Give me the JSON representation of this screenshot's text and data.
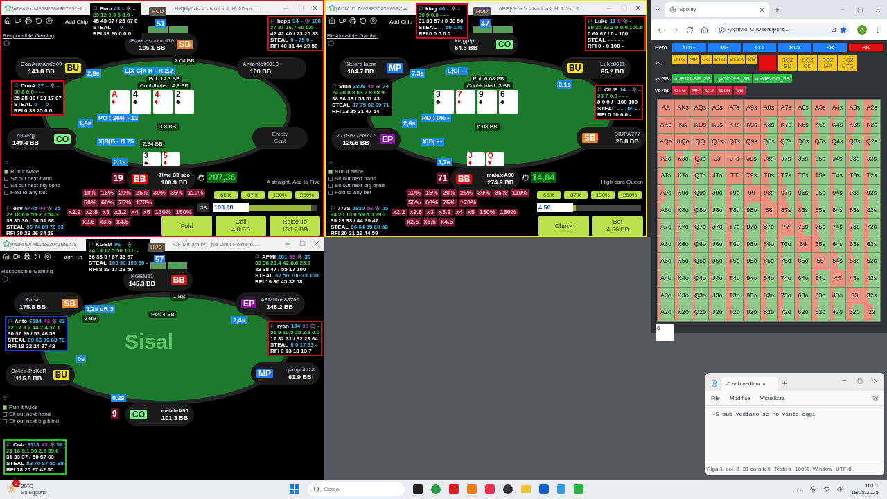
{
  "tables": [
    {
      "color": "#e01020",
      "title_left": "[ADM ID: M628E3043E7F51HL",
      "title_right": "HK]Hybris V - No Limit Hold'em…",
      "add_chips": "Add Chip",
      "hud_button": "HUD",
      "responsible": "Responsible Gaming",
      "top_number": "51",
      "hole_number": "19",
      "seats": [
        {
          "kind": "player",
          "name": "Francescomoi10",
          "stack": "105.1 BB",
          "badge": {
            "label": "SB",
            "color": "#f07c1c"
          }
        },
        {
          "kind": "player",
          "name": "DonArmando00",
          "stack": "143.8 BB",
          "badge": {
            "label": "BU",
            "color": "#f4e618"
          },
          "timer": "2,8s"
        },
        {
          "kind": "player",
          "name": "oliverjj",
          "stack": "149.4 BB",
          "badge": {
            "label": "CO",
            "color": "#7ef58a"
          },
          "timer": "1,8s"
        },
        {
          "kind": "hero",
          "name": "Time 33 sec",
          "stack": "100.9 BB",
          "badge": {
            "label": "BB",
            "color": "#e01010"
          },
          "timer": "2,1s"
        },
        {
          "kind": "empty",
          "name": "Empty Seat"
        },
        {
          "kind": "player",
          "name": "Antonio00118",
          "stack": "100 BB"
        }
      ],
      "pot": "Pot: 14.3 BB",
      "contributed": "Contributed: 4.8 BB",
      "board": [
        {
          "rank": "A",
          "suit": "♦",
          "color": "#d40000"
        },
        {
          "rank": "4",
          "suit": "♣",
          "color": "#111111"
        },
        {
          "rank": "4",
          "suit": "♦",
          "color": "#d40000"
        },
        {
          "rank": "2",
          "suit": "♣",
          "color": "#111111"
        }
      ],
      "hole_cards": [
        {
          "rank": "3",
          "suit": "♠",
          "color": "#111111"
        },
        {
          "rank": "5",
          "suit": "♦",
          "color": "#d40000"
        }
      ],
      "bets": [
        "7.64 BB",
        "3.8 BB",
        "2.84 BB"
      ],
      "action_labels": [
        "L|X C|X R - R 2,7",
        "PO : 26% - 12",
        "X|B|B - B 75"
      ],
      "huds": [
        {
          "color": "#000000",
          "name": "Fran",
          "count": "43",
          "mid": "-",
          "tail": "-",
          "line2": "29 12 0.0 0 8.9 -",
          "line3": "45 43 67 / 25 67 0",
          "steal_label": "STEAL",
          "steal": "- - 0 - -",
          "rfi": "RFI 33 20 0 0 0"
        },
        {
          "color": "#d0101e",
          "name": "bepp",
          "count": "94",
          "mid": "-",
          "tail": "100",
          "line2": "37 27 16.7 60 0.0 -",
          "line3": "42 42 40 / 73 20 33",
          "steal_label": "STEAL",
          "steal": "0 - 75 0 -",
          "rfi": "RFI 40 31 44 29 50"
        },
        {
          "color": "#d0101e",
          "name": "DonA",
          "count": "27",
          "mid": "-",
          "tail": "-",
          "line2": "50 8 0.0 - - -",
          "line3": "25 25 38 / 13 17 67",
          "steal_label": "STEAL",
          "steal": "0 - - 0 -",
          "rfi": "RFI 0 33 25 0 0"
        },
        {
          "color": "#000000",
          "name": "oliv",
          "count": "6445",
          "mid": "44",
          "tail": "65",
          "line2": "22 18 8.6 55 2.2 54.3",
          "line3": "36 35 30 / 56 51 68",
          "steal_label": "STEAL",
          "steal": "90 74 89 70 63",
          "rfi": "RFI 20 23 26 34 39"
        }
      ],
      "options": [
        {
          "label": "Run it twice",
          "checked": true
        },
        {
          "label": "Sit out next hand",
          "checked": false
        },
        {
          "label": "Sit out next big blind",
          "checked": false
        },
        {
          "label": "Fold to any bet",
          "checked": false
        }
      ],
      "balance": "207,36",
      "hand_name": "A straight, Ace to Five",
      "sizing_rows": [
        [
          "10%",
          "15%",
          "20%",
          "25%",
          "30%",
          "35%",
          "110%"
        ],
        [
          "50%",
          "60%",
          "75%",
          "170%"
        ],
        [
          "x2.2",
          "x2.8",
          "x3",
          "x3.2",
          "x4",
          "x5",
          "130%",
          "150%"
        ],
        [
          "x2.5",
          "x3.5",
          "x4.5"
        ]
      ],
      "presets": [
        "65%",
        "87%",
        "130%",
        "250%"
      ],
      "bb_box": "33",
      "amount": "103.68",
      "slider": {
        "level": 0.92
      },
      "actions": [
        {
          "label": "Fold"
        },
        {
          "label": "Call",
          "sub": "4.8 BB"
        },
        {
          "label": "Raise To",
          "sub": "103.7 BB"
        }
      ]
    },
    {
      "color": "#f2e600",
      "title_left": "[ADM ID: M628E3043E85FCW",
      "title_right": "0PP]Vera V - No Limit Hold'em €…",
      "add_chips": "Add Chip",
      "hud_button": "HUD",
      "responsible": "Responsible Gaming",
      "top_number": "47",
      "hole_number": "71",
      "seats": [
        {
          "kind": "player",
          "name": "kingpipp",
          "stack": "64.3 BB",
          "badge": {
            "label": "CO",
            "color": "#7ef58a"
          }
        },
        {
          "kind": "player",
          "name": "StuartHazar",
          "stack": "104.7 BB",
          "badge": {
            "label": "MP",
            "color": "#1e7cf0"
          },
          "timer": "7,3s"
        },
        {
          "kind": "player",
          "name": "777Se77eN777",
          "stack": "126.6 BB",
          "badge": {
            "label": "EP",
            "color": "#8a1aa0"
          },
          "timer": "2,6s"
        },
        {
          "kind": "hero",
          "name": "maiaieA90",
          "stack": "274.9 BB",
          "badge": {
            "label": "BB",
            "color": "#e01010"
          },
          "timer": "3,7s"
        },
        {
          "kind": "player",
          "name": "CIUPA777",
          "stack": "25.8 BB",
          "badge": {
            "label": "SB",
            "color": "#f07c1c"
          }
        },
        {
          "kind": "player",
          "name": "Luke8611",
          "stack": "95.2 BB",
          "badge": {
            "label": "BU",
            "color": "#f4e618"
          },
          "timer": "0,1s"
        }
      ],
      "pot": "Pot: 6.08 BB",
      "contributed": "Contributed: 3 BB",
      "board": [
        {
          "rank": "3",
          "suit": "♣",
          "color": "#111111"
        },
        {
          "rank": "7",
          "suit": "♦",
          "color": "#d40000"
        },
        {
          "rank": "9",
          "suit": "♠",
          "color": "#111111"
        },
        {
          "rank": "6",
          "suit": "♣",
          "color": "#111111"
        }
      ],
      "hole_cards": [
        {
          "rank": "J",
          "suit": "♦",
          "color": "#d40000"
        },
        {
          "rank": "Q",
          "suit": "♥",
          "color": "#d40000"
        }
      ],
      "bets": [
        "6.08 BB"
      ],
      "action_labels": [
        "L|C| - -",
        "PO : 0% -",
        "X|B| - -"
      ],
      "huds": [
        {
          "color": "#d0101e",
          "name": "king",
          "count": "46",
          "mid": "-",
          "tail": "-",
          "line2": "39 0 0.0 - - -",
          "line3": "31 33 57 / 0 33 50",
          "steal_label": "STEAL",
          "steal": "- - 50 100 -",
          "rfi": "RFI 0 0 0 0 0"
        },
        {
          "color": "#d0101e",
          "name": "Luke",
          "count": "11",
          "mid": "0",
          "tail": "-",
          "line2": "60 20 33.3 0 0.0 100.0",
          "line3": "0 60 67 / 0 - 100",
          "steal_label": "STEAL",
          "steal": "- - - - -",
          "rfi": "RFI 0 - 0 100 -"
        },
        {
          "color": "#000000",
          "name": "Stua",
          "count": "3308",
          "mid": "45",
          "tail": "74",
          "line2": "24 20 8.8 63 2.8 88.9",
          "line3": "38 36 38 / 58 51 43",
          "steal_label": "STEAL",
          "steal": "87 75 92 69 71",
          "rfi": "RFI 18 25 31 47 54"
        },
        {
          "color": "#d0101e",
          "name": "CIUP",
          "count": "14",
          "mid": "-",
          "tail": "-",
          "line2": "29 7 0.0 - - -",
          "line3": "0 0 0 / - 100 100",
          "steal_label": "STEAL",
          "steal": "- - 100 - -",
          "rfi": "RFI 0 50 0 0 -"
        },
        {
          "color": "#000000",
          "name": "777S",
          "count": "1830",
          "mid": "56",
          "tail": "25",
          "line2": "24 20 13.0 59 5.0 29.2",
          "line3": "39 29 33 / 44 39 47",
          "steal_label": "STEAL",
          "steal": "86 64 85 60 38",
          "rfi": "RFI 20 21 29 44 59"
        }
      ],
      "options": [
        {
          "label": "Run it twice",
          "checked": true
        },
        {
          "label": "Sit out next hand",
          "checked": false
        },
        {
          "label": "Sit out next big blind",
          "checked": false
        },
        {
          "label": "Fold to any bet",
          "checked": false
        }
      ],
      "balance": "14,84",
      "hand_name": "High card Queen",
      "sizing_rows": [
        [
          "10%",
          "15%",
          "20%",
          "25%",
          "30%",
          "35%",
          "110%"
        ],
        [
          "50%",
          "60%",
          "75%",
          "170%"
        ],
        [
          "x2.2",
          "x2.8",
          "x3",
          "x3.2",
          "x4",
          "x5",
          "130%",
          "150%"
        ],
        [
          "x2.5",
          "x3.5",
          "x4.5"
        ]
      ],
      "presets": [
        "65%",
        "87%",
        "130%",
        "250%"
      ],
      "amount": "4.56",
      "slider": {
        "level": 0.04
      },
      "actions": [
        {
          "label": "Check"
        },
        {
          "label": "Bet",
          "sub": "4.56 BB"
        }
      ]
    },
    {
      "title_left": "[ADM ID: M628E3043E82D8",
      "title_right": "OF]Miriam IV - No Limit Hold'em…",
      "add_chips": "Add Ch",
      "hud_button": "HUD",
      "responsible": "Responsible Gaming",
      "top_number": "57",
      "hole_number": "9",
      "logo": "Sisal",
      "seats": [
        {
          "kind": "player",
          "name": "KGEM11",
          "stack": "145.3 BB",
          "badge": {
            "label": "BB",
            "color": "#e01010"
          }
        },
        {
          "kind": "player",
          "name": "Raise",
          "stack": "175.8 BB",
          "badge": {
            "label": "SB",
            "color": "#f07c1c"
          },
          "timer": "3,2s oR 3"
        },
        {
          "kind": "player",
          "name": "Cr4zY-PoKeR",
          "stack": "115.8 BB",
          "badge": {
            "label": "BU",
            "color": "#f4e618"
          },
          "timer": "0s"
        },
        {
          "kind": "hero",
          "name": "maiaieA90",
          "stack": "101.3 BB",
          "badge": {
            "label": "CO",
            "color": "#7ef58a"
          },
          "timer": "0,2s"
        },
        {
          "kind": "player",
          "name": "ryanpolli28",
          "stack": "61.9 BB",
          "badge": {
            "label": "MP",
            "color": "#1e7cf0"
          }
        },
        {
          "kind": "player",
          "name": "APMilloa88700",
          "stack": "148.2 BB",
          "badge": {
            "label": "EP",
            "color": "#8a1aa0"
          },
          "timer": "2,4s"
        }
      ],
      "pot": "Pot: 4 BB",
      "bets": [
        "1 BB",
        "3 BB"
      ],
      "huds": [
        {
          "color": "#000000",
          "name": "KGEM",
          "count": "96",
          "mid": "-",
          "tail": "-",
          "line2": "24 18 12.5 50 10.0 -",
          "line3": "36 33 0 / 67 33 67",
          "steal_label": "STEAL",
          "steal": "100 33 100 50 -",
          "rfi": "RFI 8 33 17 29 50"
        },
        {
          "color": "#000000",
          "name": "APMi",
          "count": "201",
          "mid": "39",
          "tail": "50",
          "line2": "33 30 21.4 42 8.8 25.0",
          "line3": "43 38 47 / 55 17 100",
          "steal_label": "STEAL",
          "steal": "67 50 100 33 100",
          "rfi": "RFI 19 30 45 32 58"
        },
        {
          "color": "#1a3cff",
          "name": "Anto",
          "count": "6194",
          "mid": "43",
          "tail": "63",
          "line2": "22 17 8.2 44 2.4 57.1",
          "line3": "30 37 29 / 53 46 56",
          "steal_label": "STEAL",
          "steal": "89 66 90 68 73",
          "rfi": "RFI 18 22 24 37 42"
        },
        {
          "color": "#d0101e",
          "name": "ryan",
          "count": "134",
          "mid": "30",
          "tail": "-",
          "line2": "51 9 10.5 25 2.3 0.0",
          "line3": "17 32 31 / 32 29 64",
          "steal_label": "STEAL",
          "steal": "0 0 17 33 -",
          "rfi": "RFI 0 13 18 13 7"
        },
        {
          "color": "#22c322",
          "name": "Cr4z",
          "count": "3118",
          "mid": "45",
          "tail": "56",
          "line2": "23 18 9.1 56 2.9 55.6",
          "line3": "31 33 37 / 50 57 69",
          "steal_label": "STEAL",
          "steal": "83 70 87 55 38",
          "rfi": "RFI 18 20 27 42 55"
        }
      ],
      "options": [
        {
          "label": "Run it twice",
          "checked": true
        },
        {
          "label": "Sit out next hand",
          "checked": false
        },
        {
          "label": "Sit out next big blind",
          "checked": false
        }
      ]
    }
  ],
  "browser": {
    "tab": "Spotify",
    "address_chip": "Archivio",
    "address": "C:/Users/porz...",
    "avatar": "A",
    "range_rows": [
      {
        "label": "Hero",
        "color": "#1e80ff",
        "items": [
          {
            "label": "UTG",
            "selected": false
          },
          {
            "label": "MP",
            "selected": false
          },
          {
            "label": "CO",
            "selected": false
          },
          {
            "label": "BTN",
            "selected": false
          },
          {
            "label": "SB",
            "selected": false
          },
          {
            "label": "BB",
            "selected": true
          }
        ]
      },
      {
        "label": "vs",
        "color": "#f5c518",
        "items": [
          {
            "label": "UTG",
            "selected": false
          },
          {
            "label": "MP",
            "selected": false
          },
          {
            "label": "CO",
            "selected": false
          },
          {
            "label": "BTN",
            "selected": false
          },
          {
            "label": "BLSX",
            "selected": false
          },
          {
            "label": "SB",
            "selected": false
          },
          {
            "selected": true
          },
          {
            "label": "SQZ BU",
            "selected": false
          },
          {
            "label": "SQZ CO",
            "selected": false
          },
          {
            "label": "SQZ MP",
            "selected": false
          },
          {
            "label": "SQZ UTG",
            "selected": false
          }
        ]
      },
      {
        "label": "vs 3B",
        "color": "#2fb84a",
        "items": [
          {
            "label": "opBTN-SB_3B",
            "selected": false
          },
          {
            "label": "opCO-SB_3B",
            "selected": false
          },
          {
            "label": "opMP-CO_3B",
            "selected": false
          }
        ]
      },
      {
        "label": "vs 4B",
        "color": "#d0243e",
        "items": [
          {
            "label": "UTG",
            "selected": false
          },
          {
            "label": "MP",
            "selected": false
          },
          {
            "label": "CO",
            "selected": false
          },
          {
            "label": "BTN",
            "selected": false
          },
          {
            "label": "SB",
            "selected": false
          }
        ]
      }
    ],
    "grid": [
      [
        {
          "hand": "AA",
          "level": 1
        },
        {
          "hand": "AKs",
          "level": 1
        },
        {
          "hand": "AQs",
          "level": 1
        },
        {
          "hand": "AJs",
          "level": 1
        },
        {
          "hand": "ATs",
          "level": 1
        },
        {
          "hand": "A9s",
          "level": 1
        },
        {
          "hand": "A8s",
          "level": 1
        },
        {
          "hand": "A7s",
          "level": 1
        },
        {
          "hand": "A6s",
          "level": 0.4
        },
        {
          "hand": "A5s",
          "level": 1
        },
        {
          "hand": "A4s",
          "level": 0.6
        },
        {
          "hand": "A3s",
          "level": 0.6
        },
        {
          "hand": "A2s",
          "level": 0.6
        }
      ],
      [
        {
          "hand": "AKo",
          "level": 1
        },
        {
          "hand": "KK",
          "level": 1
        },
        {
          "hand": "KQs",
          "level": 1
        },
        {
          "hand": "KJs",
          "level": 1
        },
        {
          "hand": "KTs",
          "level": 1
        },
        {
          "hand": "K9s",
          "level": 1
        },
        {
          "hand": "K8s",
          "level": 0.4
        },
        {
          "hand": "K7s",
          "level": 0.5
        },
        {
          "hand": "K6s",
          "level": 0.6
        },
        {
          "hand": "K5s",
          "level": 0.3
        },
        {
          "hand": "K4s",
          "level": 0.3
        },
        {
          "hand": "K3s",
          "level": 0.5
        },
        {
          "hand": "K2s",
          "level": 0.5
        }
      ],
      [
        {
          "hand": "AQo",
          "level": 1
        },
        {
          "hand": "KQo",
          "level": 1
        },
        {
          "hand": "QQ",
          "level": 1
        },
        {
          "hand": "QJs",
          "level": 1
        },
        {
          "hand": "QTs",
          "level": 1
        },
        {
          "hand": "Q9s",
          "level": 1
        },
        {
          "hand": "Q8s",
          "level": 0.3
        },
        {
          "hand": "Q7s",
          "level": 0.3
        },
        {
          "hand": "Q6s",
          "level": 0.3
        },
        {
          "hand": "Q5s",
          "level": 0.4
        },
        {
          "hand": "Q4s",
          "level": 0.3
        },
        {
          "hand": "Q3s",
          "level": 0.3
        },
        {
          "hand": "Q2s",
          "level": 0.4
        }
      ],
      [
        {
          "hand": "AJo",
          "level": 0.5
        },
        {
          "hand": "KJo",
          "level": 0.5
        },
        {
          "hand": "QJo",
          "level": 0.5
        },
        {
          "hand": "JJ",
          "level": 1
        },
        {
          "hand": "JTs",
          "level": 1
        },
        {
          "hand": "J9s",
          "level": 0.6
        },
        {
          "hand": "J8s",
          "level": 0.4
        },
        {
          "hand": "J7s",
          "level": 0.2
        },
        {
          "hand": "J6s",
          "level": 0.2
        },
        {
          "hand": "J5s",
          "level": 0.2
        },
        {
          "hand": "J4s",
          "level": 0.2
        },
        {
          "hand": "J3s",
          "level": 0.2
        },
        {
          "hand": "J2s",
          "level": 0.3
        }
      ],
      [
        {
          "hand": "ATo",
          "level": 0.3
        },
        {
          "hand": "KTo",
          "level": 0.2
        },
        {
          "hand": "QTo",
          "level": 0.2
        },
        {
          "hand": "JTo",
          "level": 0.3
        },
        {
          "hand": "TT",
          "level": 1
        },
        {
          "hand": "T9s",
          "level": 0.5
        },
        {
          "hand": "T8s",
          "level": 0.5
        },
        {
          "hand": "T7s",
          "level": 0.3
        },
        {
          "hand": "T6s",
          "level": 0.3
        },
        {
          "hand": "T5s",
          "level": 0.3
        },
        {
          "hand": "T4s",
          "level": 0.3
        },
        {
          "hand": "T3s",
          "level": 0.3
        },
        {
          "hand": "T2s",
          "level": 0.3
        }
      ],
      [
        {
          "hand": "A9o",
          "level": 0.4
        },
        {
          "hand": "K9o",
          "level": 0.2
        },
        {
          "hand": "Q9o",
          "level": 0.2
        },
        {
          "hand": "J9o",
          "level": 0.2
        },
        {
          "hand": "T9o",
          "level": 0.3
        },
        {
          "hand": "99",
          "level": 1
        },
        {
          "hand": "98s",
          "level": 0.6
        },
        {
          "hand": "97s",
          "level": 0.5
        },
        {
          "hand": "96s",
          "level": 0.3
        },
        {
          "hand": "95s",
          "level": 0.3
        },
        {
          "hand": "94s",
          "level": 0.3
        },
        {
          "hand": "93s",
          "level": 0.3
        },
        {
          "hand": "92s",
          "level": 0.3
        }
      ],
      [
        {
          "hand": "A8o",
          "level": 0.2
        },
        {
          "hand": "K8o",
          "level": 0.2
        },
        {
          "hand": "Q8o",
          "level": 0.2
        },
        {
          "hand": "J8o",
          "level": 0.2
        },
        {
          "hand": "T8o",
          "level": 0.3
        },
        {
          "hand": "98o",
          "level": 0.3
        },
        {
          "hand": "88",
          "level": 1
        },
        {
          "hand": "87s",
          "level": 0.6
        },
        {
          "hand": "86s",
          "level": 0.4
        },
        {
          "hand": "85s",
          "level": 0.4
        },
        {
          "hand": "84s",
          "level": 0.3
        },
        {
          "hand": "83s",
          "level": 0.3
        },
        {
          "hand": "82s",
          "level": 0.3
        }
      ],
      [
        {
          "hand": "A7o",
          "level": 0.2
        },
        {
          "hand": "K7o",
          "level": 0.2
        },
        {
          "hand": "Q7o",
          "level": 0.2
        },
        {
          "hand": "J7o",
          "level": 0.2
        },
        {
          "hand": "T7o",
          "level": 0.3
        },
        {
          "hand": "97o",
          "level": 0.3
        },
        {
          "hand": "87o",
          "level": 0.3
        },
        {
          "hand": "77",
          "level": 1
        },
        {
          "hand": "76s",
          "level": 0.5
        },
        {
          "hand": "75s",
          "level": 0.4
        },
        {
          "hand": "74s",
          "level": 0.3
        },
        {
          "hand": "73s",
          "level": 0.3
        },
        {
          "hand": "72s",
          "level": 0.3
        }
      ],
      [
        {
          "hand": "A6o",
          "level": 0.2
        },
        {
          "hand": "K6o",
          "level": 0.2
        },
        {
          "hand": "Q6o",
          "level": 0.2
        },
        {
          "hand": "J6o",
          "level": 0.2
        },
        {
          "hand": "T6o",
          "level": 0.3
        },
        {
          "hand": "96o",
          "level": 0.3
        },
        {
          "hand": "86o",
          "level": 0.3
        },
        {
          "hand": "76o",
          "level": 0.3
        },
        {
          "hand": "66",
          "level": 1
        },
        {
          "hand": "65s",
          "level": 0.5
        },
        {
          "hand": "64s",
          "level": 0.3
        },
        {
          "hand": "63s",
          "level": 0.3
        },
        {
          "hand": "62s",
          "level": 0.3
        }
      ],
      [
        {
          "hand": "A5o",
          "level": 0.2
        },
        {
          "hand": "K5o",
          "level": 0.2
        },
        {
          "hand": "Q5o",
          "level": 0.2
        },
        {
          "hand": "J5o",
          "level": 0.2
        },
        {
          "hand": "T5o",
          "level": 0.3
        },
        {
          "hand": "95o",
          "level": 0.3
        },
        {
          "hand": "85o",
          "level": 0.3
        },
        {
          "hand": "75o",
          "level": 0.3
        },
        {
          "hand": "65o",
          "level": 0.3
        },
        {
          "hand": "55",
          "level": 1
        },
        {
          "hand": "54s",
          "level": 0.5
        },
        {
          "hand": "53s",
          "level": 0.4
        },
        {
          "hand": "52s",
          "level": 0.3
        }
      ],
      [
        {
          "hand": "A4o",
          "level": 0.2
        },
        {
          "hand": "K4o",
          "level": 0.2
        },
        {
          "hand": "Q4o",
          "level": 0.2
        },
        {
          "hand": "J4o",
          "level": 0.2
        },
        {
          "hand": "T4o",
          "level": 0.3
        },
        {
          "hand": "94o",
          "level": 0.3
        },
        {
          "hand": "84o",
          "level": 0.3
        },
        {
          "hand": "74o",
          "level": 0.3
        },
        {
          "hand": "64o",
          "level": 0.3
        },
        {
          "hand": "54o",
          "level": 0.3
        },
        {
          "hand": "44",
          "level": 1
        },
        {
          "hand": "43s",
          "level": 0.4
        },
        {
          "hand": "42s",
          "level": 0.3
        }
      ],
      [
        {
          "hand": "A3o",
          "level": 0.2
        },
        {
          "hand": "K3o",
          "level": 0.2
        },
        {
          "hand": "Q3o",
          "level": 0.2
        },
        {
          "hand": "J3o",
          "level": 0.2
        },
        {
          "hand": "T3o",
          "level": 0.3
        },
        {
          "hand": "93o",
          "level": 0.3
        },
        {
          "hand": "83o",
          "level": 0.3
        },
        {
          "hand": "73o",
          "level": 0.3
        },
        {
          "hand": "63o",
          "level": 0.3
        },
        {
          "hand": "53o",
          "level": 0.3
        },
        {
          "hand": "43o",
          "level": 0.3
        },
        {
          "hand": "33",
          "level": 1
        },
        {
          "hand": "32s",
          "level": 0.3
        }
      ],
      [
        {
          "hand": "A2o",
          "level": 0.2
        },
        {
          "hand": "K2o",
          "level": 0.2
        },
        {
          "hand": "Q2o",
          "level": 0.2
        },
        {
          "hand": "J2o",
          "level": 0.2
        },
        {
          "hand": "T2o",
          "level": 0.3
        },
        {
          "hand": "92o",
          "level": 0.3
        },
        {
          "hand": "82o",
          "level": 0.3
        },
        {
          "hand": "72o",
          "level": 0.3
        },
        {
          "hand": "62o",
          "level": 0.3
        },
        {
          "hand": "52o",
          "level": 0.3
        },
        {
          "hand": "42o",
          "level": 0.3
        },
        {
          "hand": "32o",
          "level": 0.3
        },
        {
          "hand": "22",
          "level": 0.6
        }
      ]
    ],
    "note_box": "6"
  },
  "notepad": {
    "tab": "-5 sub vediam",
    "menus": [
      "File",
      "Modifica",
      "Visualizza"
    ],
    "text": "-5 sub vediamo se ho vinto oggi",
    "status": [
      "Riga 1, col. 2",
      "31 caratteri",
      "Testo s",
      "100%",
      "Window",
      "UTF-8"
    ]
  },
  "taskbar": {
    "weather_badge": "3",
    "temperature": "30°C",
    "weather": "Soleggiato",
    "search": "Cerca",
    "time": "16:01",
    "date": "18/08/2025"
  }
}
